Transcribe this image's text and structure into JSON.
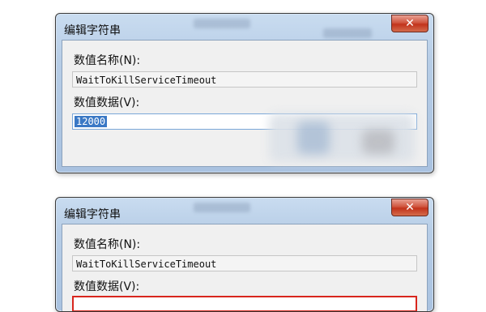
{
  "dialogs": [
    {
      "title": "编辑字符串",
      "close_glyph": "✕",
      "value_name_label": "数值名称",
      "value_name_key": "(N):",
      "value_name": "WaitToKillServiceTimeout",
      "value_data_label": "数值数据",
      "value_data_key": "(V):",
      "value_data": "12000"
    },
    {
      "title": "编辑字符串",
      "close_glyph": "✕",
      "value_name_label": "数值名称",
      "value_name_key": "(N):",
      "value_name": "WaitToKillServiceTimeout",
      "value_data_label": "数值数据",
      "value_data_key": "(V):"
    }
  ]
}
